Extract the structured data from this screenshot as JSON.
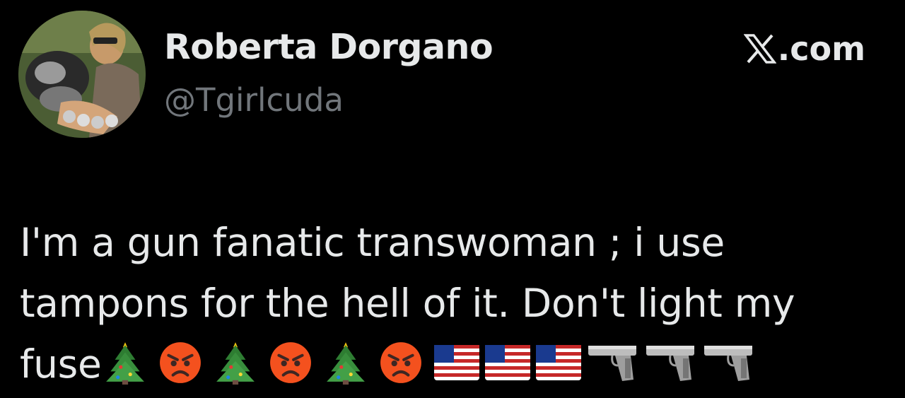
{
  "author": {
    "display_name": "Roberta Dorgano",
    "handle": "@Tgirlcuda",
    "avatar_icon": "profile-photo"
  },
  "brand": {
    "label": ".com",
    "icon": "x-logo-icon"
  },
  "tweet": {
    "line1": "I'm a gun fanatic transwoman ; i use",
    "line2": "tampons for the hell of it. Don't light my",
    "line3": "fuse",
    "emojis": [
      "christmas-tree-icon",
      "angry-face-icon",
      "christmas-tree-icon",
      "angry-face-icon",
      "christmas-tree-icon",
      "angry-face-icon",
      "us-flag-icon",
      "us-flag-icon",
      "us-flag-icon",
      "pistol-icon",
      "pistol-icon",
      "pistol-icon"
    ]
  },
  "colors": {
    "background": "#000000",
    "primary_text": "#e7e9ea",
    "secondary_text": "#71767b"
  }
}
